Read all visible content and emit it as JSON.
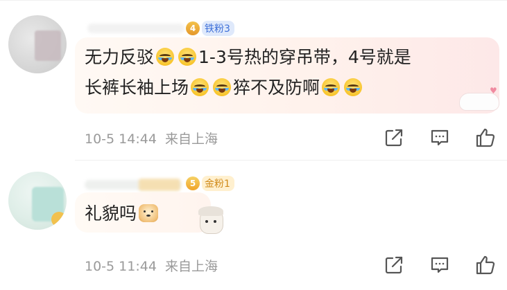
{
  "comments": [
    {
      "fan_level": "4",
      "fan_badge": "铁粉3",
      "text_line1_a": "无力反驳",
      "text_line1_b": "1-3号热的穿吊带，4号就是",
      "text_line2_a": "长裤长袖上场",
      "text_line2_b": "猝不及防啊",
      "emojis": [
        "crying-laughing",
        "crying-laughing",
        "crying-laughing",
        "crying-laughing",
        "crying-laughing",
        "crying-laughing"
      ],
      "timestamp": "10-5 14:44",
      "location": "来自上海"
    },
    {
      "fan_level": "5",
      "fan_badge": "金粉1",
      "text_line1_a": "礼貌吗",
      "emojis": [
        "doge"
      ],
      "timestamp": "10-5 11:44",
      "location": "来自上海"
    }
  ],
  "colors": {
    "iron_fan_badge": "#3d6fd8",
    "gold_fan_badge": "#d08b1a",
    "meta_text": "#9a9a9a"
  },
  "icons": [
    "share-icon",
    "comment-icon",
    "like-icon"
  ]
}
